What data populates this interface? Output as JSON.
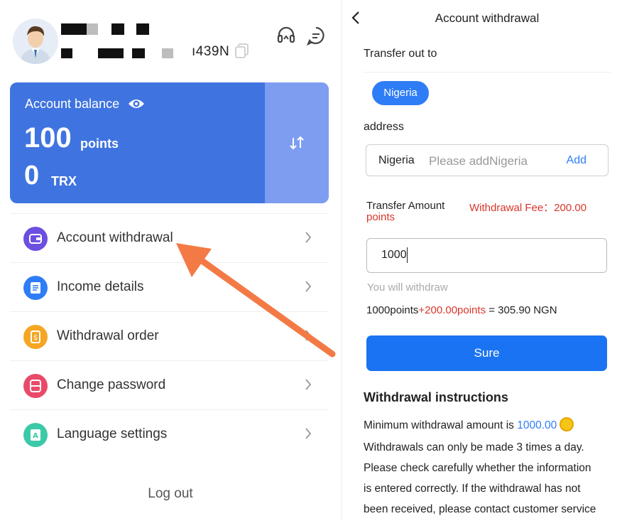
{
  "left": {
    "uid_suffix": "ı439N",
    "balance": {
      "title": "Account balance",
      "points_value": "100",
      "points_unit": "points",
      "trx_value": "0",
      "trx_unit": "TRX"
    },
    "menu": [
      {
        "label": "Account withdrawal",
        "icon": "wallet-icon",
        "color": "#6c4fe0"
      },
      {
        "label": "Income details",
        "icon": "document-icon",
        "color": "#2f7df6"
      },
      {
        "label": "Withdrawal order",
        "icon": "order-icon",
        "color": "#f5a623"
      },
      {
        "label": "Change password",
        "icon": "lock-icon",
        "color": "#e94a6a"
      },
      {
        "label": "Language settings",
        "icon": "language-icon",
        "color": "#3cc9a7"
      }
    ],
    "logout": "Log out"
  },
  "right": {
    "header": {
      "title": "Account withdrawal"
    },
    "transfer_out_label": "Transfer out to",
    "country_chip": "Nigeria",
    "address_label": "address",
    "address": {
      "country": "Nigeria",
      "placeholder": "Please addNigeria",
      "add": "Add"
    },
    "amount_label": "Transfer Amount",
    "fee_label": "Withdrawal Fee：200.00",
    "fee_unit": "points",
    "amount_value": "1000",
    "hint": "You will withdraw",
    "calc": {
      "base": "1000points",
      "fee": "+200.00points",
      "result": " = 305.90 NGN"
    },
    "sure": "Sure",
    "instructions": {
      "title": "Withdrawal instructions",
      "min_text": "Minimum withdrawal amount is ",
      "min_value": "1000.00",
      "lines": [
        "Withdrawals can only be made 3 times a day.",
        "Please check carefully whether the information",
        "is entered correctly. If the withdrawal has not",
        "been received, please contact customer service"
      ]
    }
  },
  "colors": {
    "primary": "#1a73f2",
    "card": "#3f74e0",
    "arrow": "#f47a45",
    "fee_red": "#d9362b"
  }
}
